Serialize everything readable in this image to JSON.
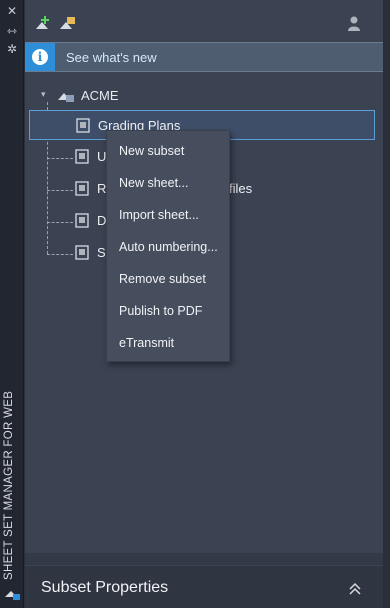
{
  "side_strip": {
    "close_glyph": "✕",
    "pin_glyph": "⇿",
    "settings_glyph": "✲",
    "title": "SHEET SET MANAGER FOR WEB"
  },
  "toolbar": {
    "icons": [
      "new-sheet-set-icon",
      "open-sheet-set-icon",
      "user-icon"
    ]
  },
  "banner": {
    "link_label": "See what's new",
    "info_glyph": "i"
  },
  "tree": {
    "caret": "▾",
    "root_label": "ACME",
    "items": [
      {
        "label": "Grading Plans",
        "selected": true
      },
      {
        "label": "U"
      },
      {
        "label": "R",
        "suffix": "files"
      },
      {
        "label": "D"
      },
      {
        "label": "S"
      }
    ]
  },
  "context_menu": {
    "items": [
      "New subset",
      "New sheet...",
      "Import sheet...",
      "Auto numbering...",
      "Remove subset",
      "Publish to PDF",
      "eTransmit"
    ]
  },
  "properties": {
    "title": "Subset Properties"
  },
  "colors": {
    "panel_bg": "#3b4353",
    "strip_bg": "#222631",
    "accent_blue": "#2f8ed8",
    "selection_border": "#5e9ed6",
    "menu_bg": "#464d5c"
  }
}
